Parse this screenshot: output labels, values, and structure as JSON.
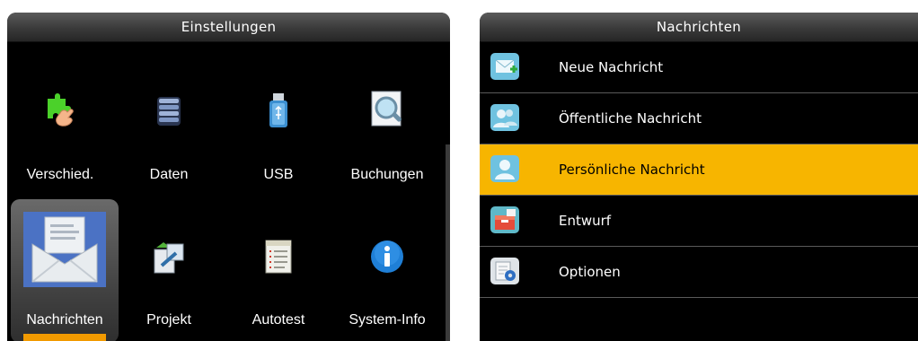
{
  "left_screen": {
    "title": "Einstellungen",
    "items": [
      {
        "label": "Verschied.",
        "icon": "puzzle-hand-icon"
      },
      {
        "label": "Daten",
        "icon": "database-icon"
      },
      {
        "label": "USB",
        "icon": "usb-drive-icon"
      },
      {
        "label": "Buchungen",
        "icon": "magnifier-document-icon"
      },
      {
        "label": "Nachrichten",
        "icon": "envelope-icon",
        "selected": true
      },
      {
        "label": "Projekt",
        "icon": "project-icon"
      },
      {
        "label": "Autotest",
        "icon": "checklist-icon"
      },
      {
        "label": "System-Info",
        "icon": "info-icon"
      }
    ]
  },
  "right_screen": {
    "title": "Nachrichten",
    "items": [
      {
        "label": "Neue Nachricht",
        "icon": "new-message-icon"
      },
      {
        "label": "Öffentliche Nachricht",
        "icon": "group-users-icon"
      },
      {
        "label": "Persönliche Nachricht",
        "icon": "user-icon",
        "selected": true
      },
      {
        "label": "Entwurf",
        "icon": "draft-box-icon"
      },
      {
        "label": "Optionen",
        "icon": "options-gear-icon"
      }
    ]
  },
  "colors": {
    "highlight": "#f7b500",
    "accent_bar": "#f29a00",
    "background": "#000000"
  }
}
